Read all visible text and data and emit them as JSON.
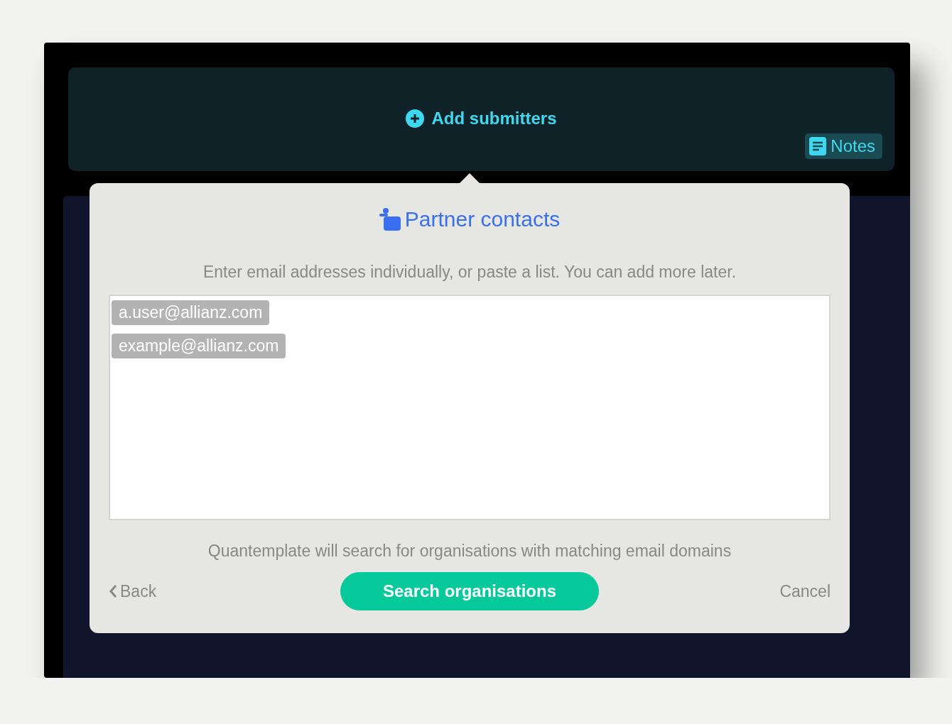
{
  "header": {
    "action": "Add submitters",
    "notes": "Notes"
  },
  "popover": {
    "title": "Partner contacts",
    "instructions": "Enter email addresses individually, or paste a list. You can add more later.",
    "emails": [
      "a.user@allianz.com",
      "example@allianz.com"
    ],
    "hint": "Quantemplate will search for organisations with matching email domains",
    "back": "Back",
    "primary": "Search organisations",
    "cancel": "Cancel"
  }
}
